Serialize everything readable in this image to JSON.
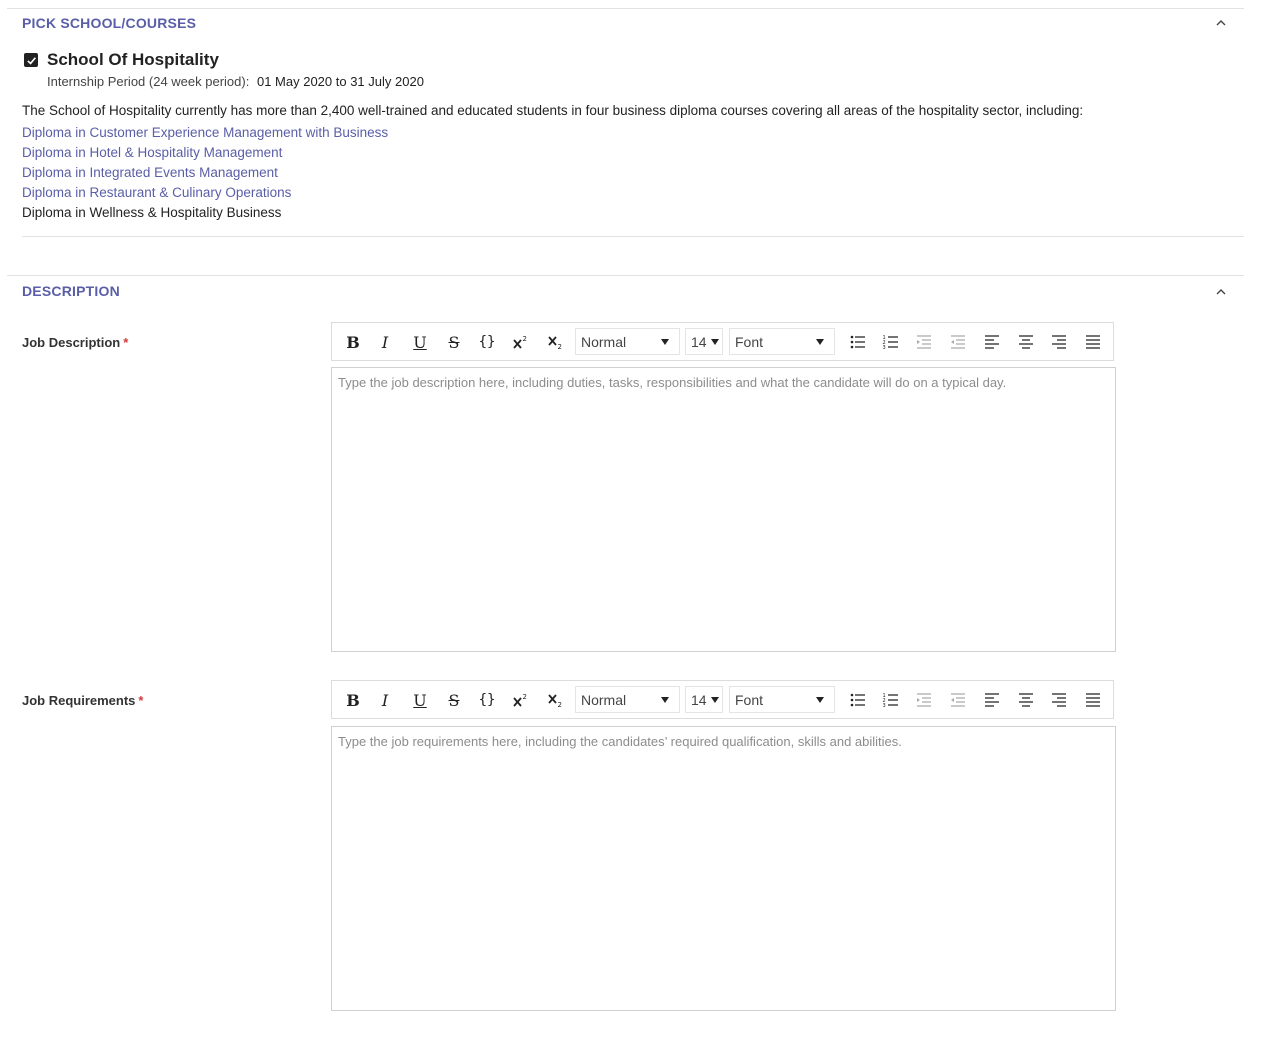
{
  "pick_section": {
    "title": "PICK SCHOOL/COURSES",
    "school": {
      "name": "School Of Hospitality",
      "checked": true,
      "period_label": "Internship Period (24 week period):",
      "period_dates": "01 May 2020 to 31 July 2020"
    },
    "intro": "The School of Hospitality currently has more than 2,400 well-trained and educated students in four business diploma courses covering all areas of the hospitality sector, including:",
    "courses": [
      "Diploma in Customer Experience Management with Business",
      "Diploma in Hotel & Hospitality Management",
      "Diploma in Integrated Events Management",
      "Diploma in Restaurant & Culinary Operations",
      "Diploma in Wellness & Hospitality Business"
    ]
  },
  "description_section": {
    "title": "DESCRIPTION",
    "required_marker": "*",
    "toolbar": {
      "bold": "B",
      "italic": "I",
      "underline": "U",
      "strike": "S",
      "code": "{}",
      "format_value": "Normal",
      "size_value": "14",
      "font_value": "Font"
    },
    "job_description": {
      "label": "Job Description",
      "placeholder": "Type the job description here, including duties, tasks, responsibilities and what the candidate will do on a typical day."
    },
    "job_requirements": {
      "label": "Job Requirements",
      "placeholder": "Type the job requirements here, including the candidates’ required qualification, skills and abilities."
    }
  },
  "colors": {
    "accent": "#5a5ea8",
    "required": "#d23c3c",
    "placeholder": "#8c8c8c"
  }
}
